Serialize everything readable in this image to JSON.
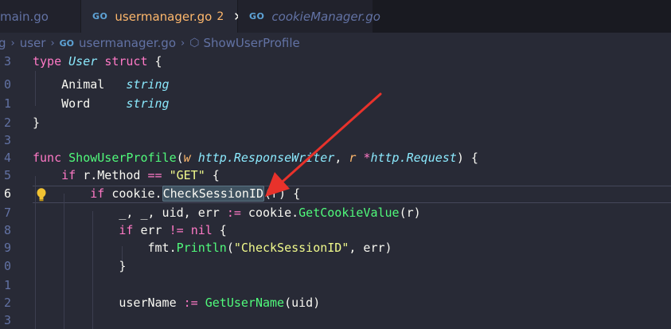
{
  "tabs": [
    {
      "label": "main.go",
      "icon": "go-file-icon",
      "icon_text": "GO"
    },
    {
      "label": "usermanager.go",
      "icon": "go-file-icon",
      "icon_text": "GO",
      "problem_count": "2",
      "close": "✕",
      "active": true
    },
    {
      "label": "cookieManager.go",
      "icon": "go-file-icon",
      "icon_text": "GO"
    }
  ],
  "breadcrumb": {
    "parts": [
      "g",
      "user",
      "usermanager.go",
      "ShowUserProfile"
    ],
    "separator": "›",
    "go_icon_text": "GO",
    "symbol_icon": "⬡"
  },
  "editor": {
    "line_numbers": [
      "3",
      "0",
      "1",
      "2",
      "3",
      "4",
      "5",
      "6",
      "7",
      "8",
      "9",
      "0",
      "1",
      "2",
      "3"
    ],
    "active_line_number": "6",
    "lightbulb_icon": "lightbulb-icon",
    "highlighted_symbol": "CheckSessionID",
    "lines": [
      [
        [
          "kw",
          "type"
        ],
        [
          "plain",
          " "
        ],
        [
          "ty",
          "User"
        ],
        [
          "plain",
          " "
        ],
        [
          "kw",
          "struct"
        ],
        [
          "plain",
          " {"
        ]
      ],
      [
        [
          "plain",
          "    Animal   "
        ],
        [
          "ty",
          "string"
        ]
      ],
      [
        [
          "plain",
          "    Word     "
        ],
        [
          "ty",
          "string"
        ]
      ],
      [
        [
          "plain",
          "}"
        ]
      ],
      [],
      [
        [
          "kw",
          "func"
        ],
        [
          "plain",
          " "
        ],
        [
          "fn",
          "ShowUserProfile"
        ],
        [
          "plain",
          "("
        ],
        [
          "par",
          "w"
        ],
        [
          "plain",
          " "
        ],
        [
          "ty",
          "http.ResponseWriter"
        ],
        [
          "plain",
          ", "
        ],
        [
          "par",
          "r"
        ],
        [
          "plain",
          " "
        ],
        [
          "kw",
          "*"
        ],
        [
          "ty",
          "http.Request"
        ],
        [
          "plain",
          ") {"
        ]
      ],
      [
        [
          "plain",
          "    "
        ],
        [
          "kw",
          "if"
        ],
        [
          "plain",
          " r.Method "
        ],
        [
          "kw",
          "=="
        ],
        [
          "plain",
          " "
        ],
        [
          "str",
          "\"GET\""
        ],
        [
          "plain",
          " {"
        ]
      ],
      [
        [
          "plain",
          "        "
        ],
        [
          "kw",
          "if"
        ],
        [
          "plain",
          " cookie."
        ],
        [
          "hl",
          "CheckSessionID"
        ],
        [
          "plain",
          "(r) {"
        ]
      ],
      [
        [
          "plain",
          "            _, _, uid, err "
        ],
        [
          "kw",
          ":="
        ],
        [
          "plain",
          " cookie."
        ],
        [
          "fn",
          "GetCookieValue"
        ],
        [
          "plain",
          "(r)"
        ]
      ],
      [
        [
          "plain",
          "            "
        ],
        [
          "kw",
          "if"
        ],
        [
          "plain",
          " err "
        ],
        [
          "kw",
          "!="
        ],
        [
          "plain",
          " "
        ],
        [
          "kw",
          "nil"
        ],
        [
          "plain",
          " {"
        ]
      ],
      [
        [
          "plain",
          "                fmt."
        ],
        [
          "fn",
          "Println"
        ],
        [
          "plain",
          "("
        ],
        [
          "str",
          "\"CheckSessionID\""
        ],
        [
          "plain",
          ", err)"
        ]
      ],
      [
        [
          "plain",
          "            }"
        ]
      ],
      [],
      [
        [
          "plain",
          "            userName "
        ],
        [
          "kw",
          ":="
        ],
        [
          "plain",
          " "
        ],
        [
          "fn",
          "GetUserName"
        ],
        [
          "plain",
          "(uid)"
        ]
      ],
      []
    ]
  },
  "colors": {
    "background": "#282a36",
    "tab_bar": "#191a21",
    "keyword": "#ff79c6",
    "type": "#8be9fd",
    "function": "#50fa7b",
    "string": "#f1fa8c",
    "parameter": "#ffb86c",
    "annotation_arrow": "#e8322b"
  }
}
